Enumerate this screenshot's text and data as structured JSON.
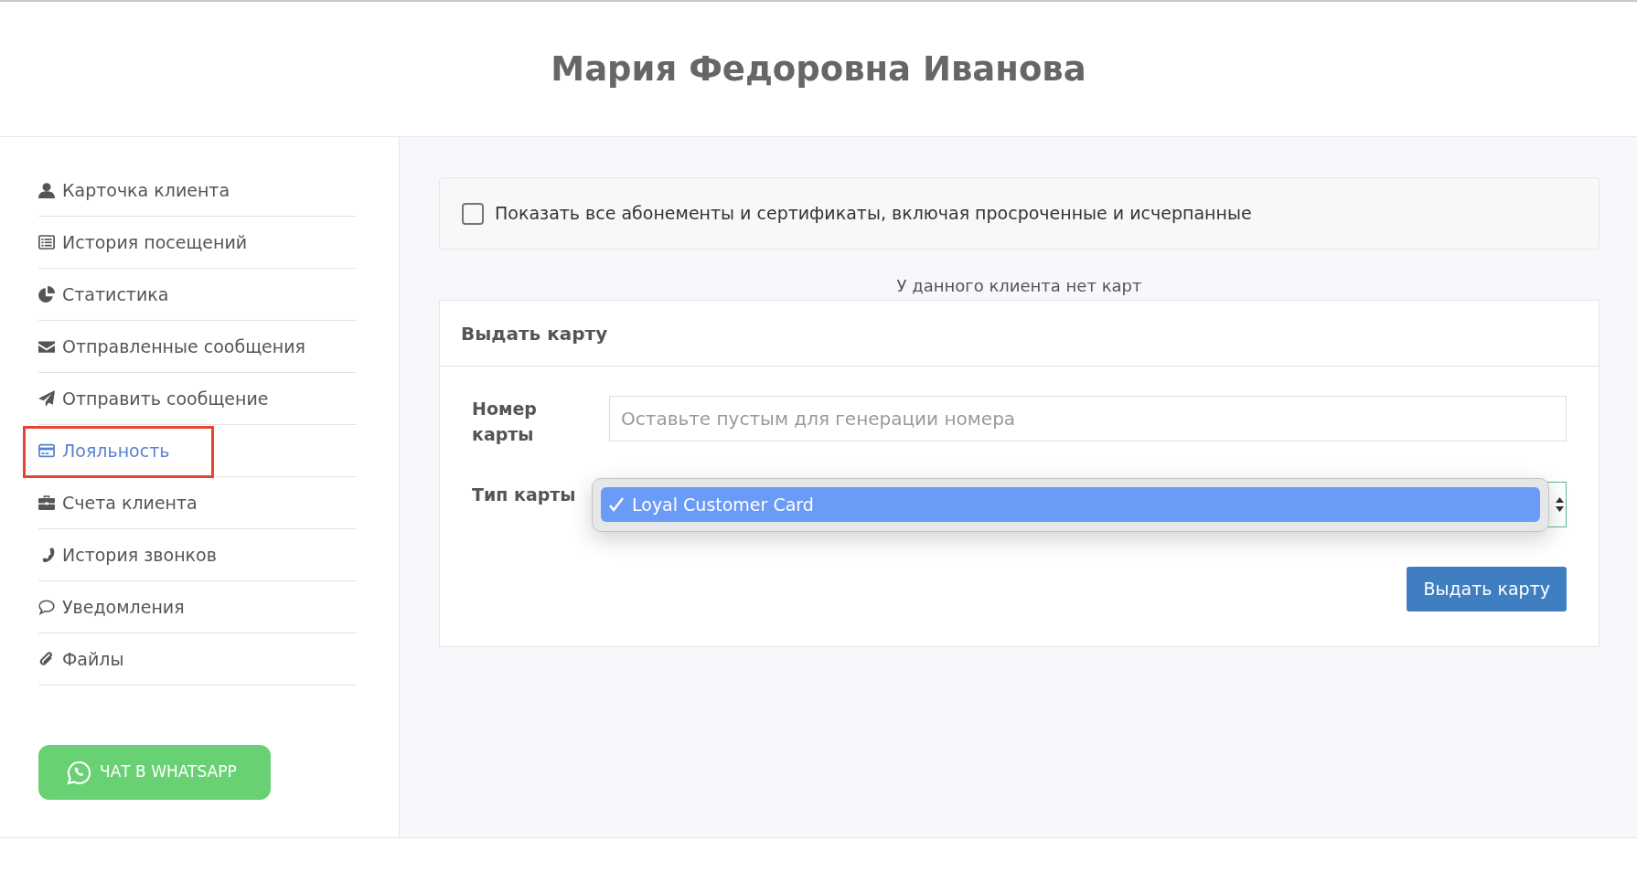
{
  "header": {
    "title": "Мария Федоровна Иванова"
  },
  "sidebar": {
    "items": [
      {
        "label": "Карточка клиента",
        "selected": false,
        "highlighted": false
      },
      {
        "label": "История посещений",
        "selected": false,
        "highlighted": false
      },
      {
        "label": "Статистика",
        "selected": false,
        "highlighted": false
      },
      {
        "label": "Отправленные сообщения",
        "selected": false,
        "highlighted": false
      },
      {
        "label": "Отправить сообщение",
        "selected": false,
        "highlighted": false
      },
      {
        "label": "Лояльность",
        "selected": true,
        "highlighted": true
      },
      {
        "label": "Счета клиента",
        "selected": false,
        "highlighted": false
      },
      {
        "label": "История звонков",
        "selected": false,
        "highlighted": false
      },
      {
        "label": "Уведомления",
        "selected": false,
        "highlighted": false
      },
      {
        "label": "Файлы",
        "selected": false,
        "highlighted": false
      }
    ],
    "whatsapp_button": "ЧАТ В WHATSAPP"
  },
  "filter": {
    "label": "Показать все абонементы и сертификаты, включая просроченные и исчерпанные",
    "checked": false
  },
  "empty_message": "У данного клиента нет карт",
  "issue_card": {
    "title": "Выдать карту",
    "number_label": "Номер карты",
    "number_placeholder": "Оставьте пустым для генерации номера",
    "type_label": "Тип карты",
    "type_options": [
      {
        "label": "Loyal Customer Card",
        "selected": true
      }
    ],
    "submit": "Выдать карту"
  }
}
